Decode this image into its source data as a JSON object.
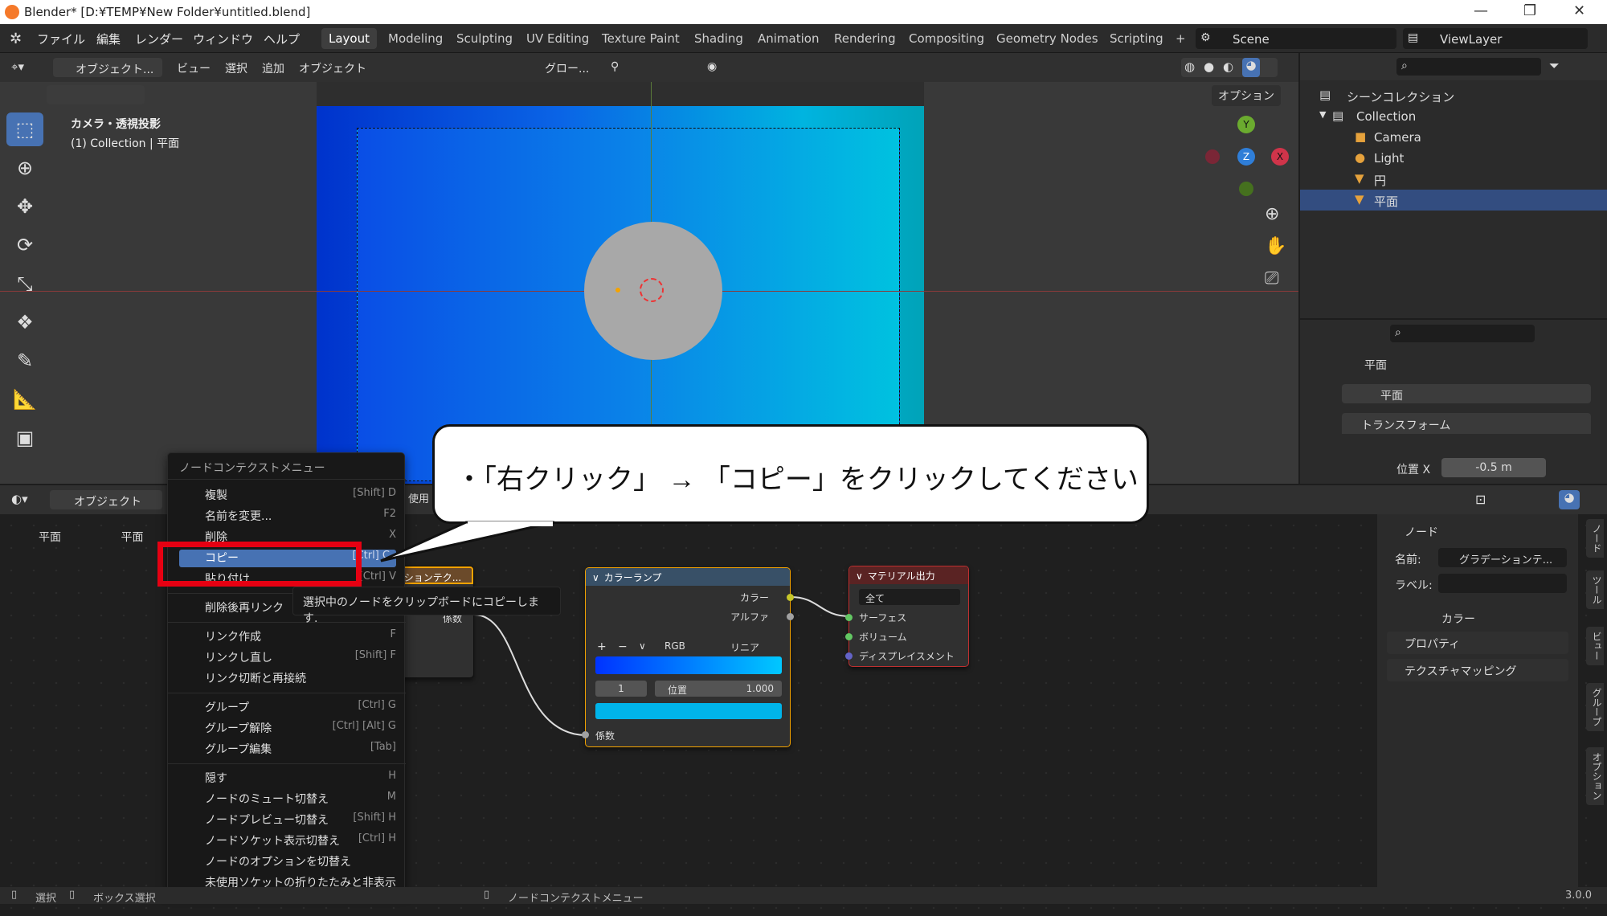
{
  "window": {
    "title": "Blender* [D:¥TEMP¥New Folder¥untitled.blend]"
  },
  "menu": [
    "ファイル",
    "編集",
    "レンダー",
    "ウィンドウ",
    "ヘルプ"
  ],
  "workspaces": [
    "Layout",
    "Modeling",
    "Sculpting",
    "UV Editing",
    "Texture Paint",
    "Shading",
    "Animation",
    "Rendering",
    "Compositing",
    "Geometry Nodes",
    "Scripting",
    "+"
  ],
  "scene": "Scene",
  "view_layer": "ViewLayer",
  "viewport_header": {
    "mode": "オブジェクト...",
    "items": [
      "ビュー",
      "選択",
      "追加",
      "オブジェクト"
    ],
    "transform": "グロー...",
    "options": "オプション"
  },
  "viewport": {
    "camera_label": "カメラ・透視投影",
    "collection_label": "(1) Collection | 平面",
    "gizmo": {
      "y": "Y",
      "z": "Z",
      "x": "X"
    }
  },
  "outliner": {
    "title": "シーンコレクション",
    "rows": [
      "Collection",
      "Camera",
      "Light",
      "円",
      "平面"
    ]
  },
  "properties": {
    "object": "平面",
    "data": "平面",
    "section": "トランスフォーム",
    "location_x_label": "位置 X",
    "location_x_value": "-0.5 m"
  },
  "node_editor": {
    "mode": "オブジェクト",
    "breadcrumb": [
      "平面",
      "平面"
    ],
    "use_label": "使用",
    "hidden_node_title": "ーションテク...",
    "hidden_node_field": "係数",
    "color_ramp": {
      "title": "カラーランプ",
      "out_color": "カラー",
      "out_alpha": "アルファ",
      "mode": "RGB",
      "interp": "リニア",
      "plus": "+",
      "minus": "−",
      "index": "1",
      "pos_label": "位置",
      "pos_value": "1.000",
      "in_fac": "係数",
      "ramp_start": "#0033ff",
      "ramp_end": "#00c8ff"
    },
    "material_output": {
      "title": "マテリアル出力",
      "target": "全て",
      "inputs": [
        "サーフェス",
        "ボリューム",
        "ディスプレイスメント"
      ]
    }
  },
  "context_menu": {
    "title": "ノードコンテクストメニュー",
    "items": [
      {
        "label": "複製",
        "key": "[Shift] D"
      },
      {
        "label": "名前を変更...",
        "key": "F2"
      },
      {
        "label": "削除",
        "key": "X"
      },
      {
        "label": "コピー",
        "key": "[Ctrl] C"
      },
      {
        "label": "貼り付け",
        "key": "[Ctrl] V"
      },
      {
        "label": "削除後再リンク",
        "key": ""
      },
      {
        "label": "リンク作成",
        "key": "F"
      },
      {
        "label": "リンクし直し",
        "key": "[Shift] F"
      },
      {
        "label": "リンク切断と再接続",
        "key": ""
      },
      {
        "label": "グループ",
        "key": "[Ctrl] G"
      },
      {
        "label": "グループ解除",
        "key": "[Ctrl] [Alt] G"
      },
      {
        "label": "グループ編集",
        "key": "[Tab]"
      },
      {
        "label": "隠す",
        "key": "H"
      },
      {
        "label": "ノードのミュート切替え",
        "key": "M"
      },
      {
        "label": "ノードプレビュー切替え",
        "key": "[Shift] H"
      },
      {
        "label": "ノードソケット表示切替え",
        "key": "[Ctrl] H"
      },
      {
        "label": "ノードのオプションを切替え",
        "key": ""
      },
      {
        "label": "未使用ソケットの折りたたみと非表示",
        "key": ""
      }
    ],
    "tooltip": "選択中のノードをクリップボードにコピーします."
  },
  "callout": {
    "text": "・「右クリック」 → 「コピー」をクリックしてください"
  },
  "npanel": {
    "node_section": "ノード",
    "name_label": "名前:",
    "name_value": "グラデーションテ...",
    "label_label": "ラベル:",
    "color_section": "カラー",
    "properties_section": "プロパティ",
    "texmap_section": "テクスチャマッピング",
    "tabs": [
      "ノード",
      "ツール",
      "ビュー",
      "グループ",
      "オプション"
    ]
  },
  "statusbar": {
    "select": "選択",
    "box": "ボックス選択",
    "context": "ノードコンテクストメニュー",
    "version": "3.0.0"
  },
  "colors": {
    "accent": "#4772b3",
    "highlight_box": "#e60012"
  }
}
